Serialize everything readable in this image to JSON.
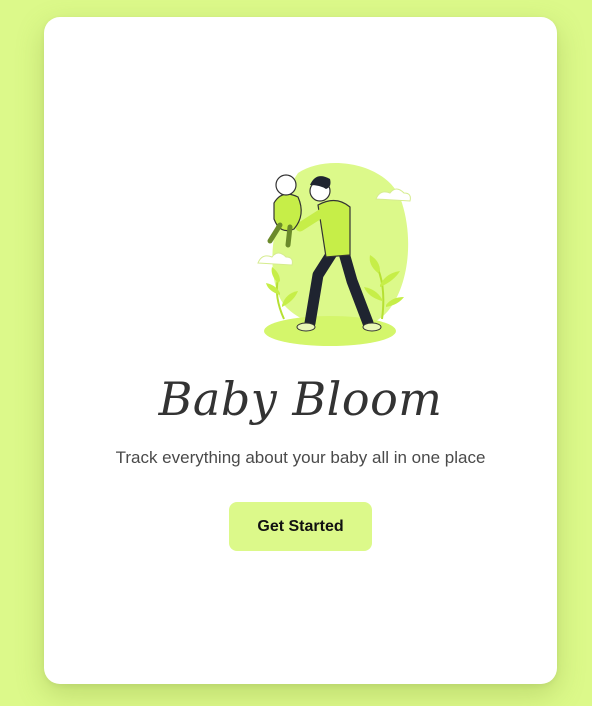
{
  "app": {
    "title": "Baby Bloom",
    "tagline": "Track everything about your baby all in one place"
  },
  "actions": {
    "get_started_label": "Get Started"
  },
  "illustration": {
    "icon": "parent-holding-baby-illustration"
  },
  "colors": {
    "background": "#dcf98a",
    "accent": "#dcf98a",
    "card": "#ffffff",
    "title_text": "#333333",
    "body_text": "#4a4a4a"
  }
}
